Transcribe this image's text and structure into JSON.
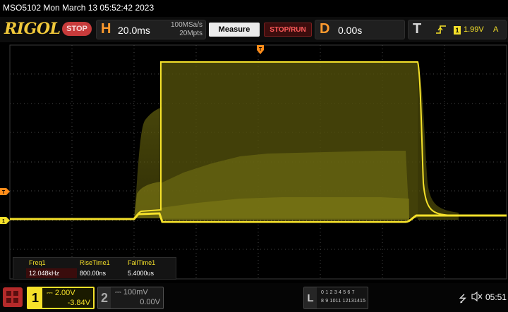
{
  "title_bar": {
    "text": "MSO5102  Mon March 13 05:52:42 2023"
  },
  "toolbar": {
    "logo": "RIGOL",
    "run_state": "STOP",
    "horizontal": {
      "label": "H",
      "timebase": "20.0ms",
      "sample_rate": "100MSa/s",
      "memory_depth": "20Mpts"
    },
    "measure_label": "Measure",
    "stop_run_label": "STOP/RUN",
    "delay": {
      "label": "D",
      "value": "0.00s"
    },
    "trigger": {
      "label": "T",
      "channel": "1",
      "level": "1.99V",
      "mode": "A"
    }
  },
  "waveform": {
    "trace_color": "#f5e12a",
    "trigger_marker_color": "#ff8c1a",
    "channel_marker_label": "1",
    "trigger_level_marker_label": "T"
  },
  "measurements": [
    {
      "name": "Freq1",
      "value": "12.048kHz"
    },
    {
      "name": "RiseTime1",
      "value": "800.00ns"
    },
    {
      "name": "FallTime1",
      "value": "5.4000us"
    }
  ],
  "bottom": {
    "ch1": {
      "number": "1",
      "scale": "2.00V",
      "offset": "-3.84V"
    },
    "ch2": {
      "number": "2",
      "scale": "100mV",
      "offset": "0.00V"
    },
    "digital": {
      "label": "L",
      "row1": "0 1 2 3  4 5 6 7",
      "row2": "8 9 1011 12131415"
    },
    "clock": "05:51"
  },
  "colors": {
    "accent": "#f5e12a",
    "stop": "#c73b3b",
    "orange": "#ff9a2e"
  }
}
